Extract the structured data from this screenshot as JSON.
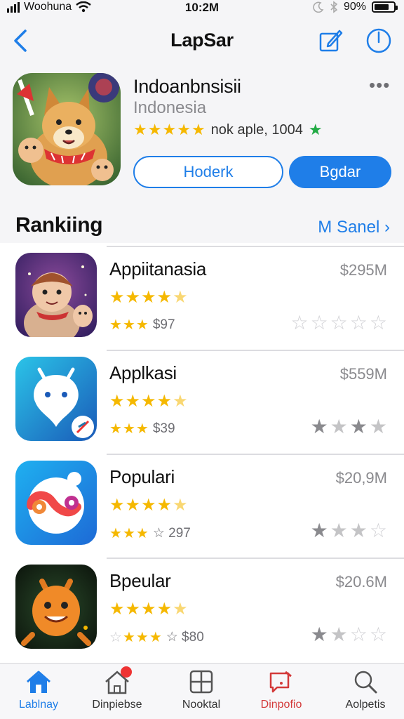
{
  "status_bar": {
    "carrier": "Woohuna",
    "time": "10:2M",
    "battery": "90%"
  },
  "nav": {
    "title": "LapSar",
    "back_icon": "chevron-left-icon",
    "edit_icon": "compose-icon",
    "power_icon": "power-icon"
  },
  "app": {
    "name": "Indoanbnsisii",
    "subtitle": "Indonesia",
    "rating_stars": 5,
    "meta": "nok aple, 1004",
    "outline_button": "Hoderk",
    "primary_button": "Bgdar",
    "more_icon": "more-dots-icon"
  },
  "section": {
    "title": "Rankiing",
    "see_all": "M Sanel"
  },
  "rows": [
    {
      "name": "Appiitanasia",
      "price": "$295M",
      "rating": 4.5,
      "sub_stars": 3,
      "sub_text": "$97",
      "secondary_rating": 0
    },
    {
      "name": "Applkasi",
      "price": "$559M",
      "rating": 4.5,
      "sub_stars": 3,
      "sub_text": "$39",
      "secondary_rating": 3.5
    },
    {
      "name": "Populari",
      "price": "$20,9M",
      "rating": 4.5,
      "sub_stars": 3,
      "sub_text": "☆ 297",
      "secondary_rating": 2.5
    },
    {
      "name": "Bpeular",
      "price": "$20.6M",
      "rating": 4.5,
      "sub_stars": 3,
      "sub_text": "☆ $80",
      "secondary_rating": 1.5
    }
  ],
  "tabs": [
    {
      "label": "Lablnay",
      "icon": "home-icon"
    },
    {
      "label": "Dinpiebse",
      "icon": "house-alert-icon"
    },
    {
      "label": "Nooktal",
      "icon": "grid-icon"
    },
    {
      "label": "Dinpofio",
      "icon": "message-alert-icon"
    },
    {
      "label": "Aolpetis",
      "icon": "search-icon"
    }
  ],
  "colors": {
    "accent": "#1f7ee8",
    "star": "#f5b800",
    "alert": "#d33a3a"
  }
}
